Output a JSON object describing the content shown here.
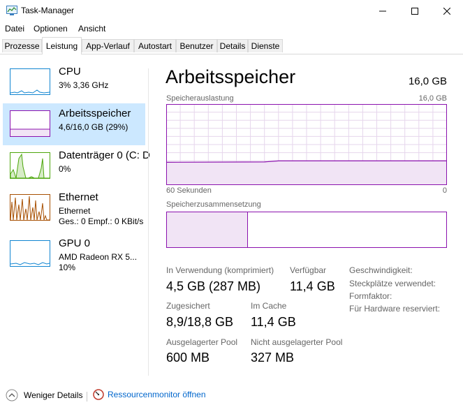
{
  "window": {
    "title": "Task-Manager"
  },
  "menu": [
    "Datei",
    "Optionen",
    "Ansicht"
  ],
  "tabs": [
    "Prozesse",
    "Leistung",
    "App-Verlauf",
    "Autostart",
    "Benutzer",
    "Details",
    "Dienste"
  ],
  "active_tab": "Leistung",
  "sidebar": [
    {
      "title": "CPU",
      "sub1": "3%  3,36 GHz",
      "sub2": "",
      "color": "#1185d1",
      "selected": false
    },
    {
      "title": "Arbeitsspeicher",
      "sub1": "4,6/16,0 GB (29%)",
      "sub2": "",
      "color": "#8b12ae",
      "selected": true
    },
    {
      "title": "Datenträger 0 (C: D",
      "sub1": "0%",
      "sub2": "",
      "color": "#4da60c",
      "selected": false
    },
    {
      "title": "Ethernet",
      "sub1": "Ethernet",
      "sub2": "Ges.: 0  Empf.: 0 KBit/s",
      "color": "#a74f01",
      "selected": false
    },
    {
      "title": "GPU 0",
      "sub1": "AMD Radeon RX 5...",
      "sub2": "10%",
      "color": "#1185d1",
      "selected": false
    }
  ],
  "main": {
    "title": "Arbeitsspeicher",
    "total": "16,0 GB",
    "usage_label": "Speicherauslastung",
    "usage_max": "16,0 GB",
    "time_left": "60 Sekunden",
    "time_right": "0",
    "composition_label": "Speicherzusammensetzung",
    "usage_fraction": 0.29,
    "composition_in_use_fraction": 0.29,
    "stats": {
      "in_use_label": "In Verwendung (komprimiert)",
      "in_use_value": "4,5 GB (287 MB)",
      "available_label": "Verfügbar",
      "available_value": "11,4 GB",
      "committed_label": "Zugesichert",
      "committed_value": "8,9/18,8 GB",
      "cached_label": "Im Cache",
      "cached_value": "11,4 GB",
      "paged_label": "Ausgelagerter Pool",
      "paged_value": "600 MB",
      "nonpaged_label": "Nicht ausgelagerter Pool",
      "nonpaged_value": "327 MB"
    },
    "right_labels": [
      "Geschwindigkeit:",
      "Steckplätze verwendet:",
      "Formfaktor:",
      "Für Hardware reserviert:"
    ]
  },
  "footer": {
    "fewer_details": "Weniger Details",
    "resource_monitor": "Ressourcenmonitor öffnen"
  },
  "colors": {
    "memory": "#8b12ae",
    "accent_link": "#0066cc",
    "selected_bg": "#cce8ff"
  }
}
